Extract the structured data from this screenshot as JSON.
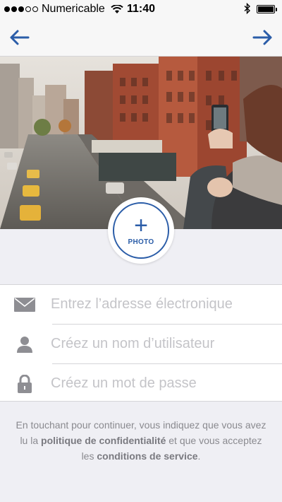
{
  "status_bar": {
    "carrier": "Numericable",
    "time": "11:40",
    "battery_level": 1.0
  },
  "nav": {
    "back_icon": "arrow-left-icon",
    "next_icon": "arrow-right-icon",
    "accent": "#2b5da8"
  },
  "photo_button": {
    "plus": "+",
    "label": "PHOTO"
  },
  "form": {
    "email_placeholder": "Entrez l’adresse électronique",
    "username_placeholder": "Créez un nom d’utilisateur",
    "password_placeholder": "Créez un mot de passe"
  },
  "legal": {
    "part1": "En touchant pour continuer, vous indiquez que vous avez lu la ",
    "privacy_link": "politique de confidentialité",
    "part2": " et que vous acceptez les ",
    "terms_link": "conditions de service",
    "part3": "."
  }
}
